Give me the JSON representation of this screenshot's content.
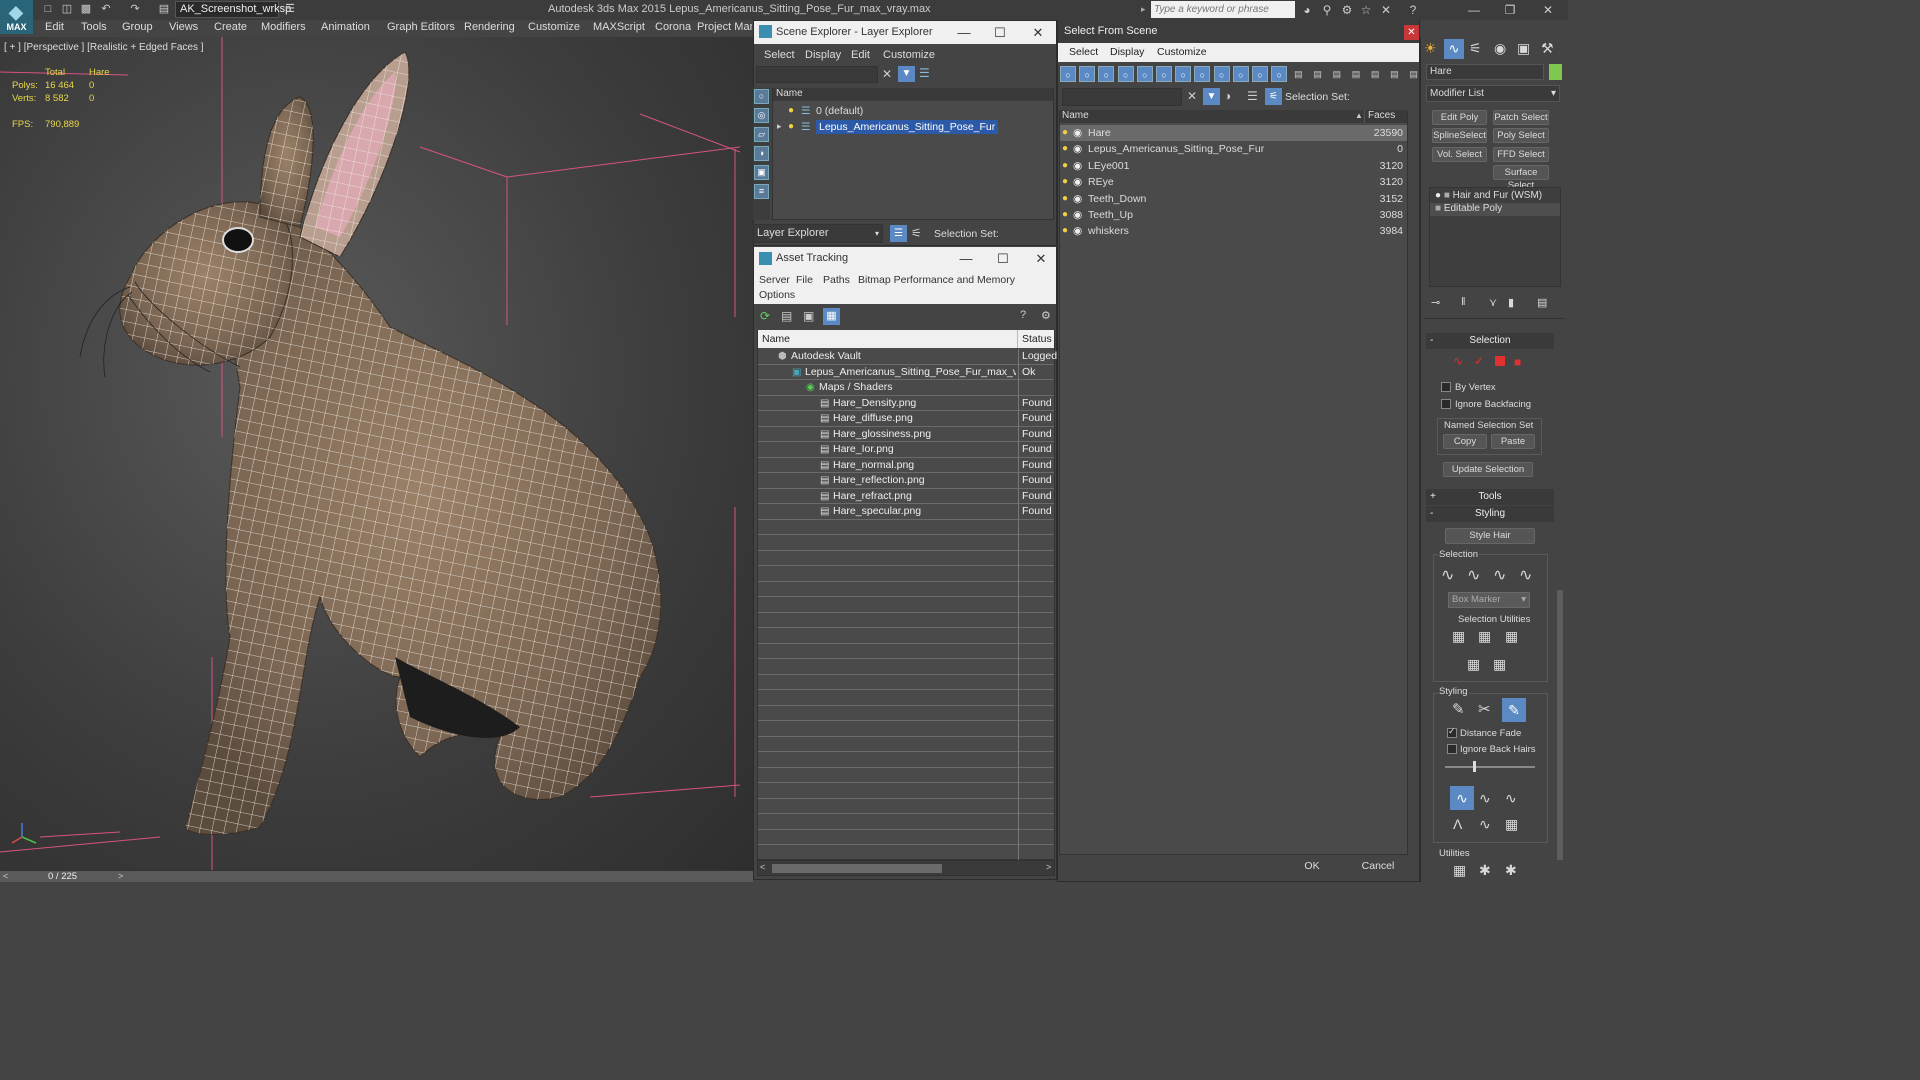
{
  "app": {
    "logo_label": "MAX",
    "workspace": "AK_Screenshot_wrksp",
    "title": "Autodesk 3ds Max  2015    Lepus_Americanus_Sitting_Pose_Fur_max_vray.max",
    "search_placeholder": "Type a keyword or phrase"
  },
  "menu": [
    "Edit",
    "Tools",
    "Group",
    "Views",
    "Create",
    "Modifiers",
    "Animation",
    "Graph Editors",
    "Rendering",
    "Customize",
    "MAXScript",
    "Corona",
    "Project Man"
  ],
  "viewport": {
    "label": "[ + ] [Perspective ] [Realistic + Edged Faces ]",
    "stats_header_total": "Total",
    "stats_header_obj": "Hare",
    "polys_label": "Polys:",
    "polys_total": "16 464",
    "polys_obj": "0",
    "verts_label": "Verts:",
    "verts_total": "8 582",
    "verts_obj": "0",
    "fps_label": "FPS:",
    "fps_value": "790,889",
    "timeline": "0 / 225"
  },
  "scene_explorer": {
    "title": "Scene Explorer - Layer Explorer",
    "menu": [
      "Select",
      "Display",
      "Edit",
      "Customize"
    ],
    "col_name": "Name",
    "layers": [
      {
        "name": "0 (default)",
        "selected": false
      },
      {
        "name": "Lepus_Americanus_Sitting_Pose_Fur",
        "selected": true
      }
    ],
    "footer_combo": "Layer Explorer",
    "selection_set_label": "Selection Set:"
  },
  "asset_tracking": {
    "title": "Asset Tracking",
    "menu": [
      "Server",
      "File",
      "Paths",
      "Bitmap Performance and Memory",
      "Options"
    ],
    "col_name": "Name",
    "col_status": "Status",
    "rows": [
      {
        "name": "Autodesk Vault",
        "status": "Logged",
        "indent": 1
      },
      {
        "name": "Lepus_Americanus_Sitting_Pose_Fur_max_vray....",
        "status": "Ok",
        "indent": 2
      },
      {
        "name": "Maps / Shaders",
        "status": "",
        "indent": 3
      },
      {
        "name": "Hare_Density.png",
        "status": "Found",
        "indent": 4
      },
      {
        "name": "Hare_diffuse.png",
        "status": "Found",
        "indent": 4
      },
      {
        "name": "Hare_glossiness.png",
        "status": "Found",
        "indent": 4
      },
      {
        "name": "Hare_Ior.png",
        "status": "Found",
        "indent": 4
      },
      {
        "name": "Hare_normal.png",
        "status": "Found",
        "indent": 4
      },
      {
        "name": "Hare_reflection.png",
        "status": "Found",
        "indent": 4
      },
      {
        "name": "Hare_refract.png",
        "status": "Found",
        "indent": 4
      },
      {
        "name": "Hare_specular.png",
        "status": "Found",
        "indent": 4
      }
    ]
  },
  "select_from_scene": {
    "title": "Select From Scene",
    "menu": [
      "Select",
      "Display",
      "Customize"
    ],
    "selection_set_label": "Selection Set:",
    "col_name": "Name",
    "col_faces": "Faces",
    "rows": [
      {
        "name": "Hare",
        "faces": "23590",
        "selected": true
      },
      {
        "name": "Lepus_Americanus_Sitting_Pose_Fur",
        "faces": "0",
        "selected": false
      },
      {
        "name": "LEye001",
        "faces": "3120",
        "selected": false
      },
      {
        "name": "REye",
        "faces": "3120",
        "selected": false
      },
      {
        "name": "Teeth_Down",
        "faces": "3152",
        "selected": false
      },
      {
        "name": "Teeth_Up",
        "faces": "3088",
        "selected": false
      },
      {
        "name": "whiskers",
        "faces": "3984",
        "selected": false
      }
    ],
    "ok": "OK",
    "cancel": "Cancel"
  },
  "command_panel": {
    "object_name": "Hare",
    "object_color": "#7ec850",
    "modifier_list": "Modifier List",
    "buttons": [
      "Edit Poly",
      "Patch Select",
      "SplineSelect",
      "Poly Select",
      "Vol. Select",
      "FFD Select",
      "Surface Select"
    ],
    "stack": [
      "Hair and Fur (WSM)",
      "Editable Poly"
    ],
    "selection_header": "Selection",
    "by_vertex": "By Vertex",
    "ignore_backfacing": "Ignore Backfacing",
    "named_selection_set": "Named Selection Set",
    "copy": "Copy",
    "paste": "Paste",
    "update_selection": "Update Selection",
    "tools_header": "Tools",
    "styling_header": "Styling",
    "style_hair": "Style Hair",
    "sub_selection": "Selection",
    "box_marker": "Box Marker",
    "selection_utilities": "Selection Utilities",
    "sub_styling": "Styling",
    "distance_fade": "Distance Fade",
    "ignore_back_hairs": "Ignore Back Hairs",
    "utilities": "Utilities"
  }
}
